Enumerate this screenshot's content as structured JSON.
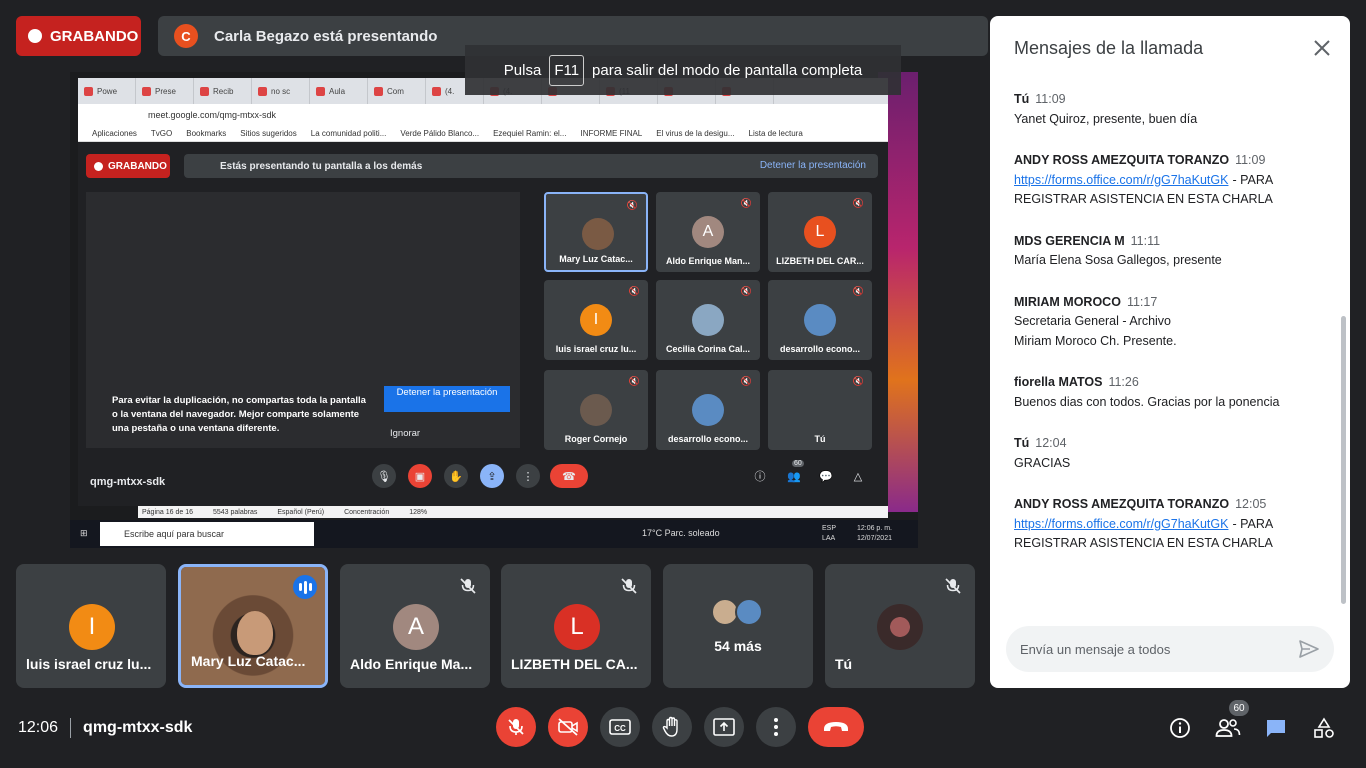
{
  "recording": {
    "label": "GRABANDO"
  },
  "presenter": {
    "initial": "C",
    "text": "Carla Begazo está presentando"
  },
  "fullscreen_banner": {
    "before": "Pulsa",
    "key": "F11",
    "after": "para salir del modo de pantalla completa"
  },
  "shared_screen": {
    "tabs": [
      "Powe",
      "Prese",
      "Recib",
      "no sc",
      "Aula",
      "Com",
      "(4.",
      "(4.",
      "",
      "(11",
      "",
      ""
    ],
    "url": "meet.google.com/qmg-mtxx-sdk",
    "bookmarks": [
      "Aplicaciones",
      "TvGO",
      "Bookmarks",
      "Sitios sugeridos",
      "La comunidad politi...",
      "Verde Pálido Blanco...",
      "Ezequiel Ramin: el...",
      "INFORME FINAL",
      "El virus de la desigu...",
      "Lista de lectura"
    ],
    "inner_recording": "GRABANDO",
    "inner_presenting": "Estás presentando tu pantalla a los demás",
    "inner_stop": "Detener la presentación",
    "warning": "Para evitar la duplicación, no compartas toda la pantalla o la ventana del navegador. Mejor comparte solamente una pestaña o una ventana diferente.",
    "stop_button": "Detener la presentación",
    "ignore": "Ignorar",
    "meeting_code": "qmg-mtxx-sdk",
    "participant_count": "60",
    "inner_tiles": [
      {
        "name": "Mary Luz Catac...",
        "initial": "",
        "color": "#7a5a44"
      },
      {
        "name": "Aldo Enrique Man...",
        "initial": "A",
        "color": "#a1887f"
      },
      {
        "name": "LIZBETH DEL CAR...",
        "initial": "L",
        "color": "#e8501f"
      },
      {
        "name": "luis israel cruz lu...",
        "initial": "I",
        "color": "#f28b14"
      },
      {
        "name": "Cecilia Corina Cal...",
        "initial": "",
        "color": "#8aa7c2"
      },
      {
        "name": "desarrollo econo...",
        "initial": "",
        "color": "#5a8bc2"
      },
      {
        "name": "Roger Cornejo",
        "initial": "",
        "color": "#6b5a4e"
      },
      {
        "name": "desarrollo econo...",
        "initial": "",
        "color": "#5a8bc2"
      },
      {
        "name": "Tú",
        "initial": "",
        "color": "#3c4043"
      }
    ],
    "word_status": [
      "Página 16 de 16",
      "5543 palabras",
      "Español (Perú)",
      "Concentración",
      "128%"
    ],
    "taskbar": {
      "search": "Escribe aquí para buscar",
      "weather": "17°C  Parc. soleado",
      "lang": "ESP LAA",
      "time": "12:06 p. m.",
      "date": "12/07/2021"
    }
  },
  "filmstrip": [
    {
      "name": "luis israel cruz lu...",
      "initial": "I",
      "color": "#f28b14",
      "muted": false,
      "active": false
    },
    {
      "name": "Mary Luz Catac...",
      "initial": "",
      "color": "",
      "muted": false,
      "active": true
    },
    {
      "name": "Aldo Enrique Ma...",
      "initial": "A",
      "color": "#a1887f",
      "muted": true,
      "active": false
    },
    {
      "name": "LIZBETH DEL CA...",
      "initial": "L",
      "color": "#d93025",
      "muted": true,
      "active": false
    },
    {
      "name": "54 más",
      "initial": "",
      "color": "",
      "muted": false,
      "active": false
    },
    {
      "name": "Tú",
      "initial": "",
      "color": "",
      "muted": true,
      "active": false
    }
  ],
  "chat": {
    "title": "Mensajes de la llamada",
    "messages": [
      {
        "sender": "Tú",
        "time": "11:09",
        "lines": [
          "Yanet Quiroz, presente, buen día"
        ],
        "link": ""
      },
      {
        "sender": "ANDY ROSS AMEZQUITA TORANZO",
        "time": "11:09",
        "link": "https://forms.office.com/r/gG7haKutGK",
        "lines": [
          "- PARA",
          "REGISTRAR ASISTENCIA EN ESTA CHARLA"
        ]
      },
      {
        "sender": "MDS GERENCIA M",
        "time": "11:11",
        "lines": [
          "María Elena Sosa Gallegos, presente"
        ],
        "link": ""
      },
      {
        "sender": "MIRIAM MOROCO",
        "time": "11:17",
        "lines": [
          "Secretaria General - Archivo",
          "Miriam Moroco Ch. Presente."
        ],
        "link": ""
      },
      {
        "sender": "fiorella MATOS",
        "time": "11:26",
        "lines": [
          "Buenos dias con todos. Gracias por la ponencia"
        ],
        "link": ""
      },
      {
        "sender": "Tú",
        "time": "12:04",
        "lines": [
          "GRACIAS"
        ],
        "link": ""
      },
      {
        "sender": "ANDY ROSS AMEZQUITA TORANZO",
        "time": "12:05",
        "link": "https://forms.office.com/r/gG7haKutGK",
        "lines": [
          "- PARA",
          "REGISTRAR ASISTENCIA EN ESTA CHARLA"
        ]
      }
    ],
    "input_placeholder": "Envía un mensaje a todos"
  },
  "bottom_bar": {
    "time": "12:06",
    "meeting_code": "qmg-mtxx-sdk",
    "people_count": "60"
  }
}
